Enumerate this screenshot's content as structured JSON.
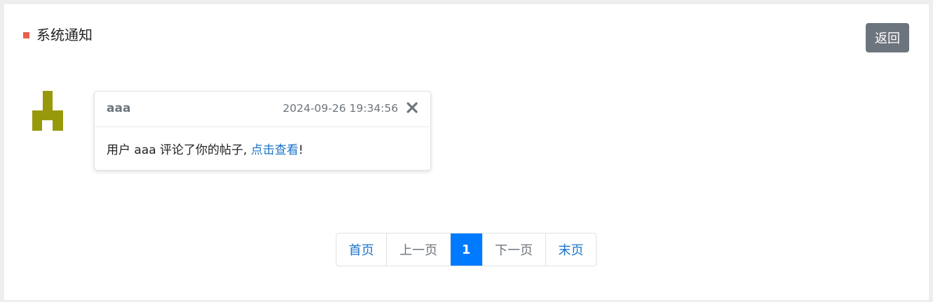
{
  "page": {
    "title": "系统通知",
    "back_label": "返回"
  },
  "colors": {
    "title_marker": "#e8604c",
    "avatar": "#97990a",
    "link": "#1a73c8",
    "active_page": "#007bff",
    "back_button": "#6c757d"
  },
  "notice": {
    "avatar_icon": "identicon-avatar",
    "sender": "aaa",
    "time": "2024-09-26 19:34:56",
    "close_icon": "close-icon",
    "message_prefix": "用户 aaa 评论了你的帖子,",
    "link_text": "点击查看",
    "message_suffix": "!"
  },
  "pagination": {
    "first": "首页",
    "prev": "上一页",
    "current": "1",
    "next": "下一页",
    "last": "末页"
  }
}
